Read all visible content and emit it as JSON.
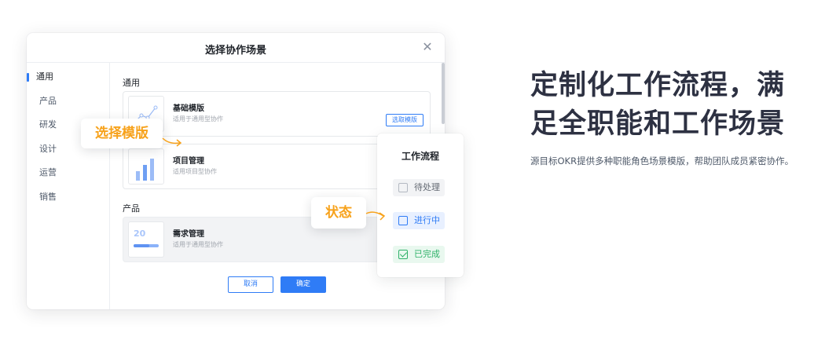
{
  "dialog": {
    "title": "选择协作场景",
    "close_icon": "close-icon",
    "sidebar": {
      "items": [
        {
          "label": "通用",
          "active": true
        },
        {
          "label": "产品",
          "active": false
        },
        {
          "label": "研发",
          "active": false
        },
        {
          "label": "设计",
          "active": false
        },
        {
          "label": "运营",
          "active": false
        },
        {
          "label": "销售",
          "active": false
        }
      ]
    },
    "sections": [
      {
        "title": "通用",
        "cards": [
          {
            "name": "基础模版",
            "desc": "适用于通用型协作",
            "action": "选取模版"
          },
          {
            "name": "项目管理",
            "desc": "适用项目型协作"
          }
        ]
      },
      {
        "title": "产品",
        "cards": [
          {
            "name": "需求管理",
            "desc": "适用于通用型协作",
            "thumb_number": "20",
            "progress": 0.62
          }
        ]
      }
    ],
    "footer": {
      "cancel": "取消",
      "confirm": "确定"
    }
  },
  "callouts": {
    "template": "选择模版",
    "status": "状态"
  },
  "workflow": {
    "title": "工作流程",
    "states": [
      {
        "label": "待处理",
        "color": "#646a73"
      },
      {
        "label": "进行中",
        "color": "#2f7cf6"
      },
      {
        "label": "已完成",
        "color": "#30b26a",
        "checked": true
      }
    ]
  },
  "marketing": {
    "headline_line1": "定制化工作流程，满",
    "headline_line2": "足全职能和工作场景",
    "subline": "源目标OKR提供多种职能角色场景模版，帮助团队成员紧密协作。"
  },
  "colors": {
    "accent": "#2f7cf6",
    "callout": "#f7a21b",
    "success": "#30b26a"
  }
}
